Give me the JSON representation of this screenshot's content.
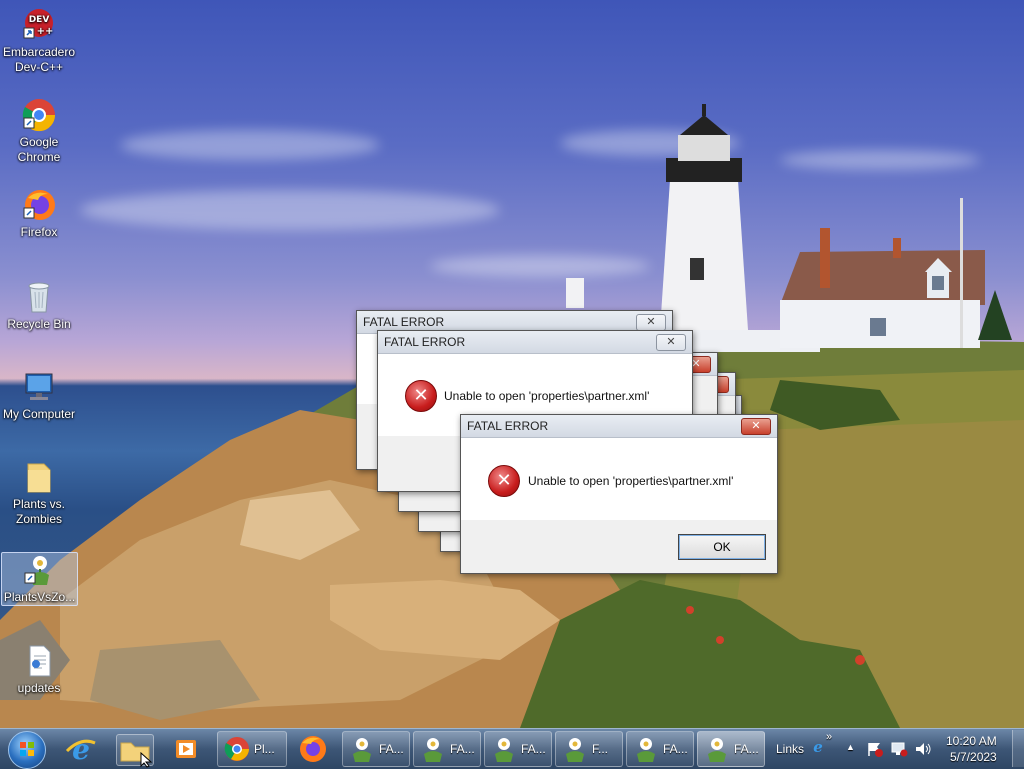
{
  "desktop": {
    "icons": [
      {
        "label": "Embarcadero Dev-C++",
        "icon": "devcpp-icon",
        "badge": "DEV"
      },
      {
        "label": "Google Chrome",
        "icon": "chrome-icon"
      },
      {
        "label": "Firefox",
        "icon": "firefox-icon"
      },
      {
        "label": "Recycle Bin",
        "icon": "recycle-bin-icon"
      },
      {
        "label": "My Computer",
        "icon": "computer-icon"
      },
      {
        "label": "Plants vs. Zombies",
        "icon": "folder-icon"
      },
      {
        "label": "PlantsVsZo...",
        "icon": "pvz-game-icon"
      },
      {
        "label": "updates",
        "icon": "document-icon"
      }
    ]
  },
  "dialogs": {
    "title": "FATAL ERROR",
    "message": "Unable to open 'properties\\partner.xml'",
    "close_glyph": "✕",
    "ok_label": "OK"
  },
  "taskbar": {
    "start_icon": "windows-start-icon",
    "pinned": [
      "internet-explorer-icon",
      "file-explorer-icon",
      "media-player-icon"
    ],
    "chrome_label": "Pl...",
    "firefox_icon": "firefox-icon",
    "task_buttons": [
      "FA...",
      "FA...",
      "FA...",
      "F...",
      "FA...",
      "FA..."
    ],
    "links_label": "Links",
    "links_chevron": "»",
    "tray_arrow": "▲",
    "clock_time": "10:20 AM",
    "clock_date": "5/7/2023"
  },
  "colors": {
    "error_red": "#c81d1d",
    "taskbar": "#3d5676",
    "sky": "#5a6cc4"
  }
}
